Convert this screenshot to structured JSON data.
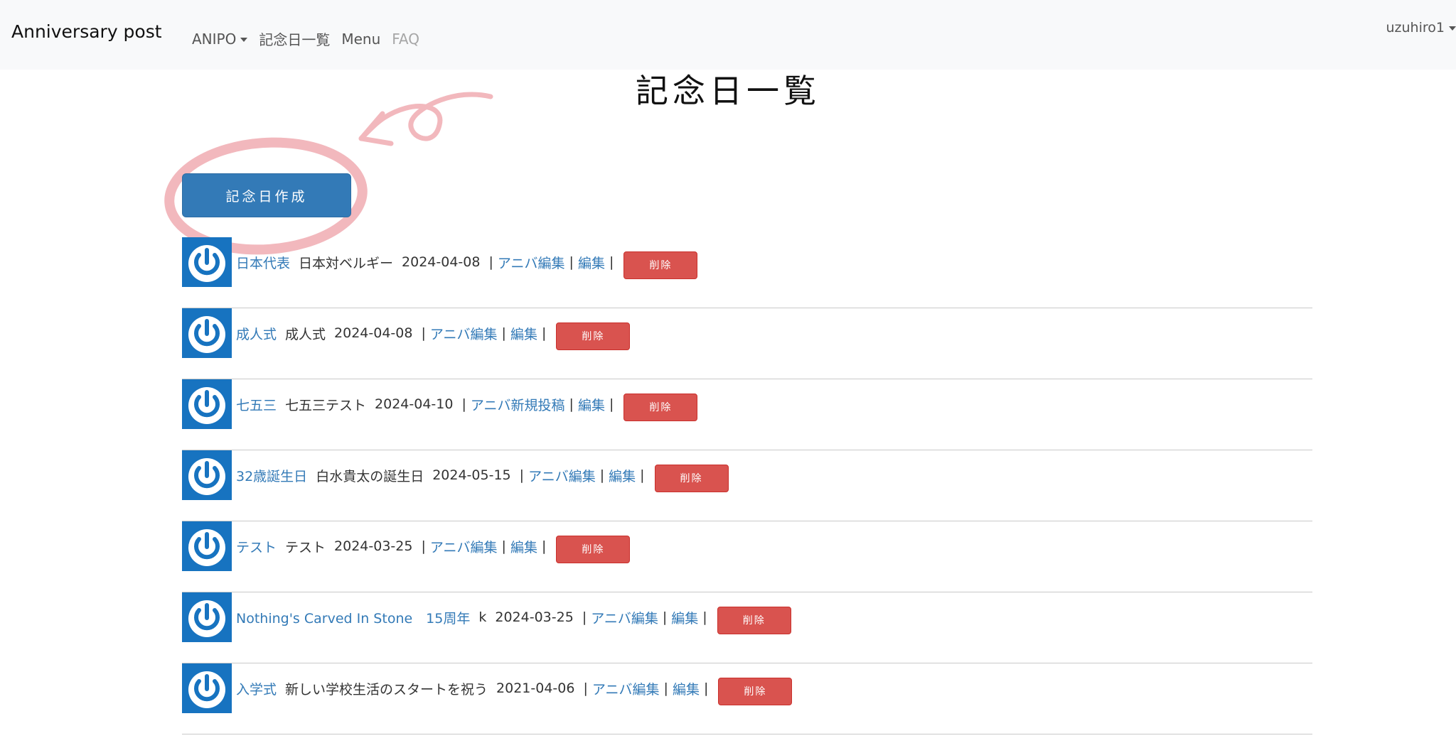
{
  "nav": {
    "brand": "Anniversary post",
    "anipo": "ANIPO",
    "list": "記念日一覧",
    "menu": "Menu",
    "faq": "FAQ",
    "user": "uzuhiro1"
  },
  "page": {
    "title": "記念日一覧",
    "create_button": "記念日作成"
  },
  "anniversaries": [
    {
      "name": "日本代表",
      "title": "日本対ベルギー",
      "date": "2024-04-08",
      "action": "アニバ編集",
      "edit": "編集",
      "delete": "削除"
    },
    {
      "name": "成人式",
      "title": "成人式",
      "date": "2024-04-08",
      "action": "アニバ編集",
      "edit": "編集",
      "delete": "削除"
    },
    {
      "name": "七五三",
      "title": "七五三テスト",
      "date": "2024-04-10",
      "action": "アニバ新規投稿",
      "edit": "編集",
      "delete": "削除"
    },
    {
      "name": "32歳誕生日",
      "title": "白水貴太の誕生日",
      "date": "2024-05-15",
      "action": "アニバ編集",
      "edit": "編集",
      "delete": "削除"
    },
    {
      "name": "テスト",
      "title": "テスト",
      "date": "2024-03-25",
      "action": "アニバ編集",
      "edit": "編集",
      "delete": "削除"
    },
    {
      "name": "Nothing's Carved In Stone　15周年",
      "title": "k",
      "date": "2024-03-25",
      "action": "アニバ編集",
      "edit": "編集",
      "delete": "削除"
    },
    {
      "name": "入学式",
      "title": "新しい学校生活のスタートを祝う",
      "date": "2021-04-06",
      "action": "アニバ編集",
      "edit": "編集",
      "delete": "削除"
    }
  ],
  "colors": {
    "primary": "#337ab7",
    "danger": "#d9534f",
    "avatar": "#1773c0",
    "annotation": "#f2b8bd",
    "navbar": "#f8f9fa"
  }
}
